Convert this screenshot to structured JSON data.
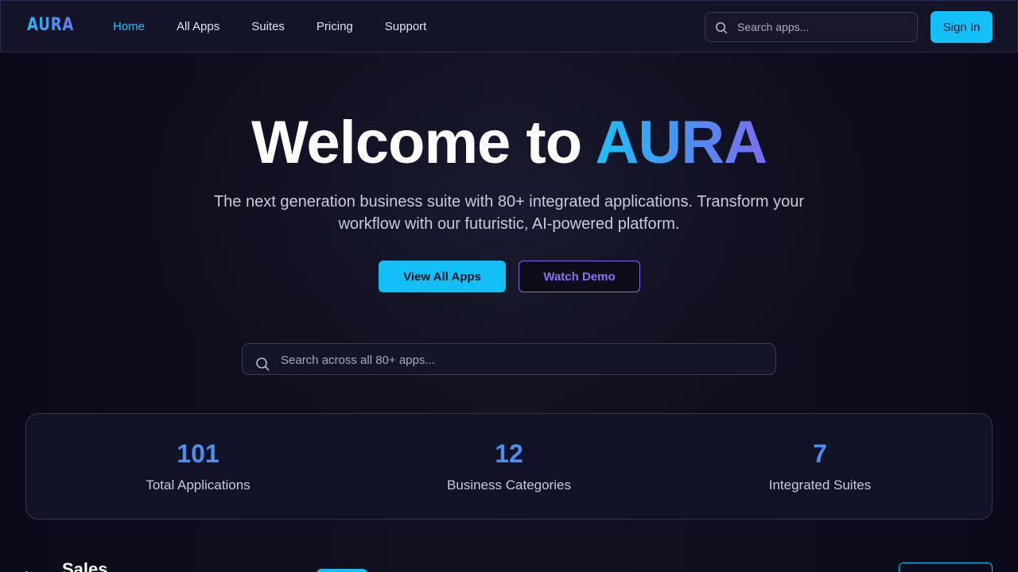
{
  "nav": {
    "logo": "AURA",
    "links": [
      {
        "label": "Home",
        "active": true
      },
      {
        "label": "All Apps",
        "active": false
      },
      {
        "label": "Suites",
        "active": false
      },
      {
        "label": "Pricing",
        "active": false
      },
      {
        "label": "Support",
        "active": false
      }
    ],
    "search_placeholder": "Search apps...",
    "signin_label": "Sign In"
  },
  "hero": {
    "title_prefix": "Welcome to ",
    "title_brand": "AURA",
    "subtitle": "The next generation business suite with 80+ integrated applications. Transform your workflow with our futuristic, AI-powered platform.",
    "primary_button": "View All Apps",
    "secondary_button": "Watch Demo",
    "search_placeholder": "Search across all 80+ apps..."
  },
  "stats": [
    {
      "value": "101",
      "label": "Total Applications"
    },
    {
      "value": "12",
      "label": "Business Categories"
    },
    {
      "value": "7",
      "label": "Integrated Suites"
    }
  ],
  "section_peek": {
    "title": "Sales"
  },
  "icons": {
    "search": "search-icon",
    "chart": "chart-icon"
  },
  "colors": {
    "accent": "#13bff7",
    "brand_gradient_start": "#1ec0f6",
    "brand_gradient_end": "#7d6cf0",
    "purple": "#8a66ef",
    "stat_value": "#4d8ef1"
  }
}
